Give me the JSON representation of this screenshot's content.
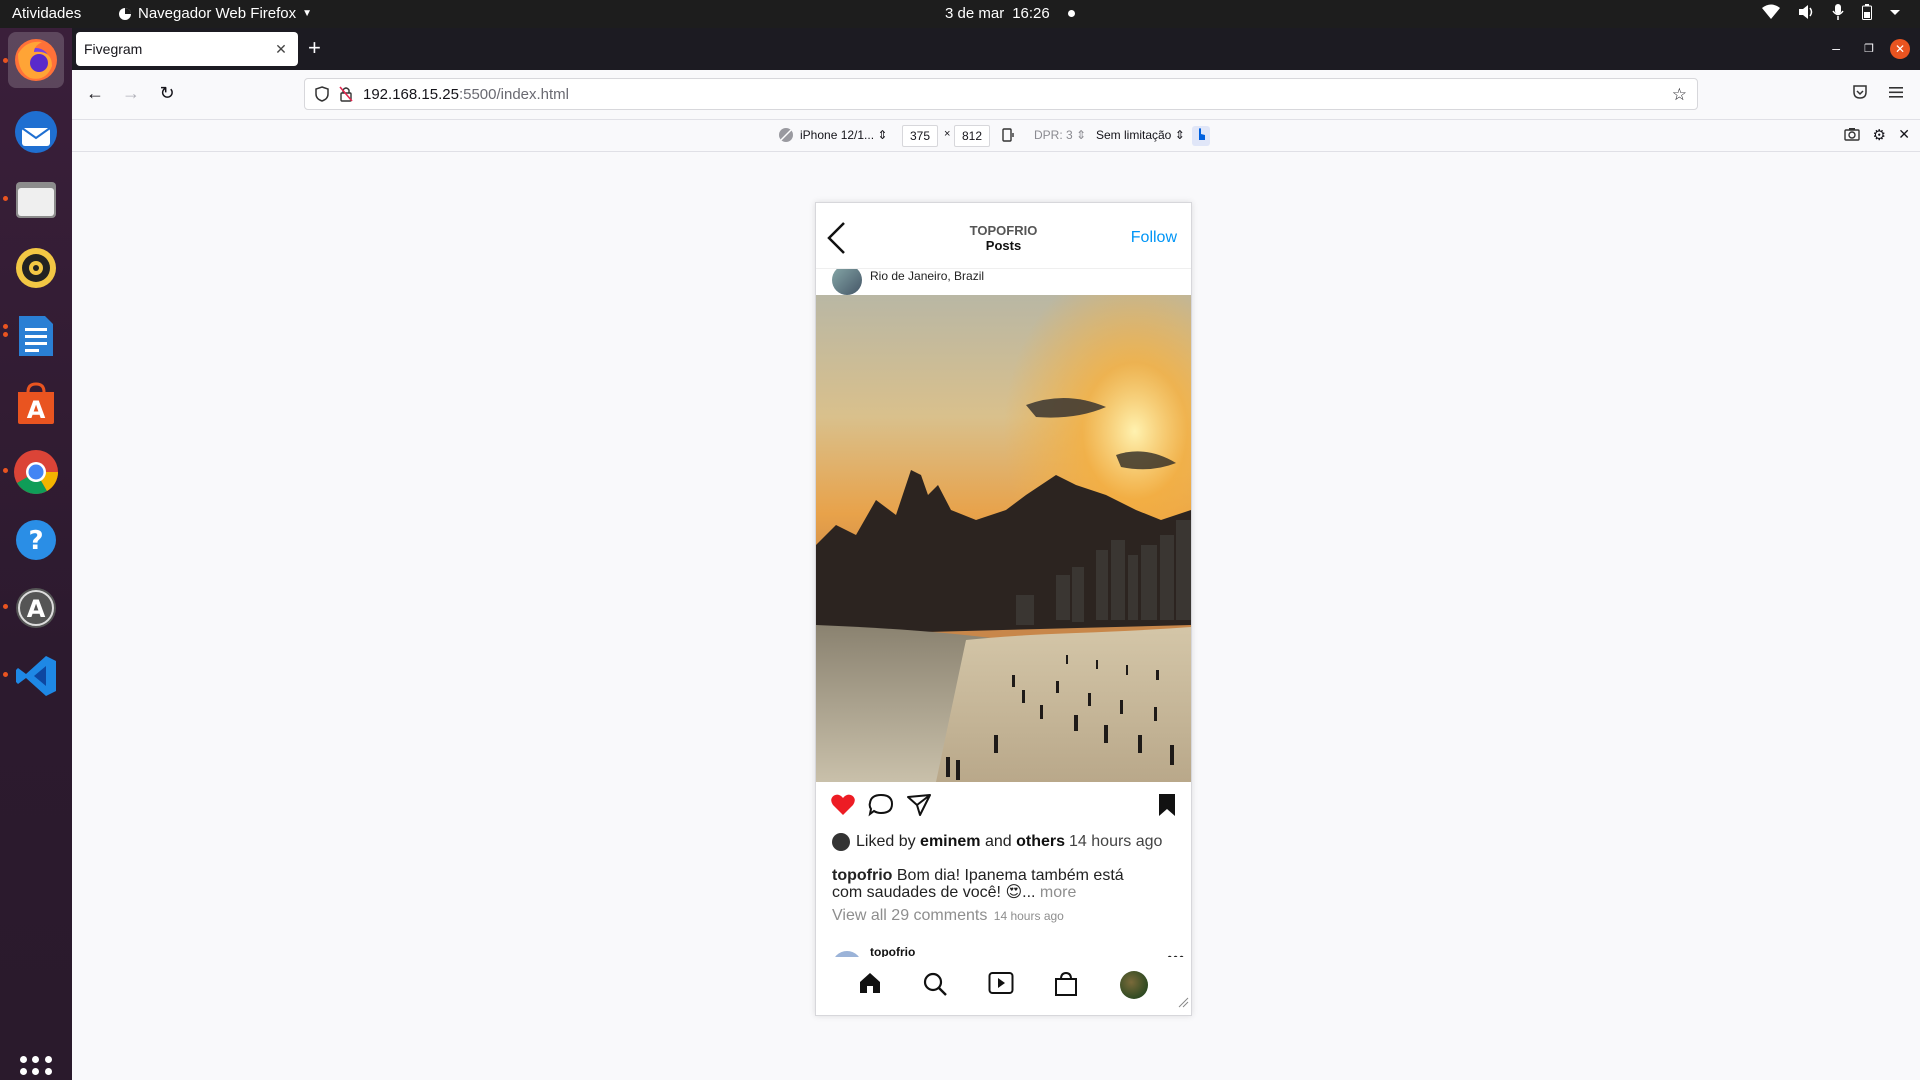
{
  "system": {
    "activities": "Atividades",
    "app_menu": "Navegador Web Firefox",
    "date": "3 de mar",
    "time": "16:26"
  },
  "browser": {
    "tab_title": "Fivegram",
    "url_host": "192.168.15.25",
    "url_path": ":5500/index.html"
  },
  "rdm": {
    "device": "iPhone 12/1...",
    "width": "375",
    "separator": "×",
    "height": "812",
    "dpr": "DPR: 3",
    "throttle": "Sem limitação"
  },
  "post": {
    "header_user": "TOPOFRIO",
    "header_sub": "Posts",
    "follow": "Follow",
    "location": "Rio de Janeiro, Brazil",
    "liked_by": "Liked by",
    "liker": "eminem",
    "and": "and",
    "others": "others",
    "time": "14 hours ago",
    "caption_user": "topofrio",
    "caption_text": "Bom dia! Ipanema também está com saudades de você! 😍...",
    "more": "more",
    "comments": "View all 29 comments",
    "comments_time": "14 hours ago",
    "next_user": "topofrio"
  },
  "colors": {
    "accent": "#0095f6",
    "heart": "#ed1c24",
    "ubuntu_orange": "#e95420"
  }
}
